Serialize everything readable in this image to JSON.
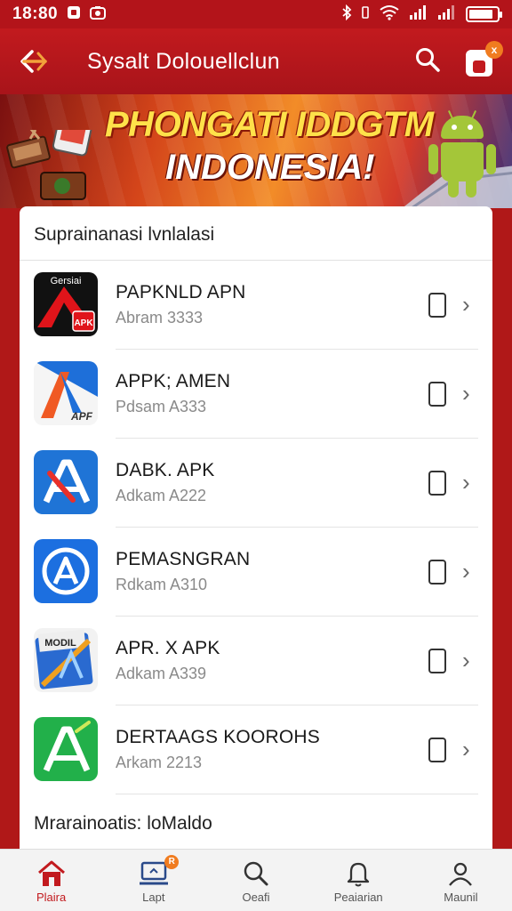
{
  "status_bar": {
    "time": "18:80",
    "notification_icons": [
      "app-notification-icon",
      "camera-notification-icon"
    ],
    "system_icons": [
      "bluetooth-icon",
      "vibrate-icon",
      "wifi-icon",
      "signal-icon",
      "signal-icon",
      "battery-icon"
    ],
    "battery_level": 0.85
  },
  "app_bar": {
    "title": "Sysalt Dolouellclun",
    "cart_badge": "x"
  },
  "banner": {
    "line1": "PHONGATI IDDGTM",
    "line2": "INDONESIA!"
  },
  "section1": {
    "title": "Suprainanasi lvnlalasi"
  },
  "apps": [
    {
      "name": "PAPKNLD APN",
      "sub": "Abram 3333",
      "icon": "red-apk-icon",
      "icon_text": "Gersiai",
      "icon_text2": "APK"
    },
    {
      "name": "APPK; AMEN",
      "sub": "Pdsam A333",
      "icon": "blue-orange-apk-icon",
      "icon_text": "APF"
    },
    {
      "name": "DABK. APK",
      "sub": "Adkam A222",
      "icon": "blue-app-store-icon"
    },
    {
      "name": "PEMASNGRAN",
      "sub": "Rdkam A310",
      "icon": "circle-app-store-icon"
    },
    {
      "name": "APR. X APK",
      "sub": "Adkam A339",
      "icon": "folder-apk-icon",
      "icon_text": "MODIL"
    },
    {
      "name": "DERTAAGS KOOROHS",
      "sub": "Arkam 2213",
      "icon": "green-app-store-icon"
    }
  ],
  "section2": {
    "title": "Mrarainoatis: loMaldo"
  },
  "nav": [
    {
      "label": "Plaira",
      "icon": "home-icon",
      "active": true
    },
    {
      "label": "Lapt",
      "icon": "laptop-icon",
      "badge": "R"
    },
    {
      "label": "Oeafi",
      "icon": "search-icon"
    },
    {
      "label": "Peaiarian",
      "icon": "bell-icon"
    },
    {
      "label": "Maunil",
      "icon": "profile-icon"
    }
  ],
  "colors": {
    "primary": "#c21a1e",
    "banner_yellow": "#ffe14a",
    "badge_orange": "#f07c20",
    "android_green": "#a4c639"
  }
}
